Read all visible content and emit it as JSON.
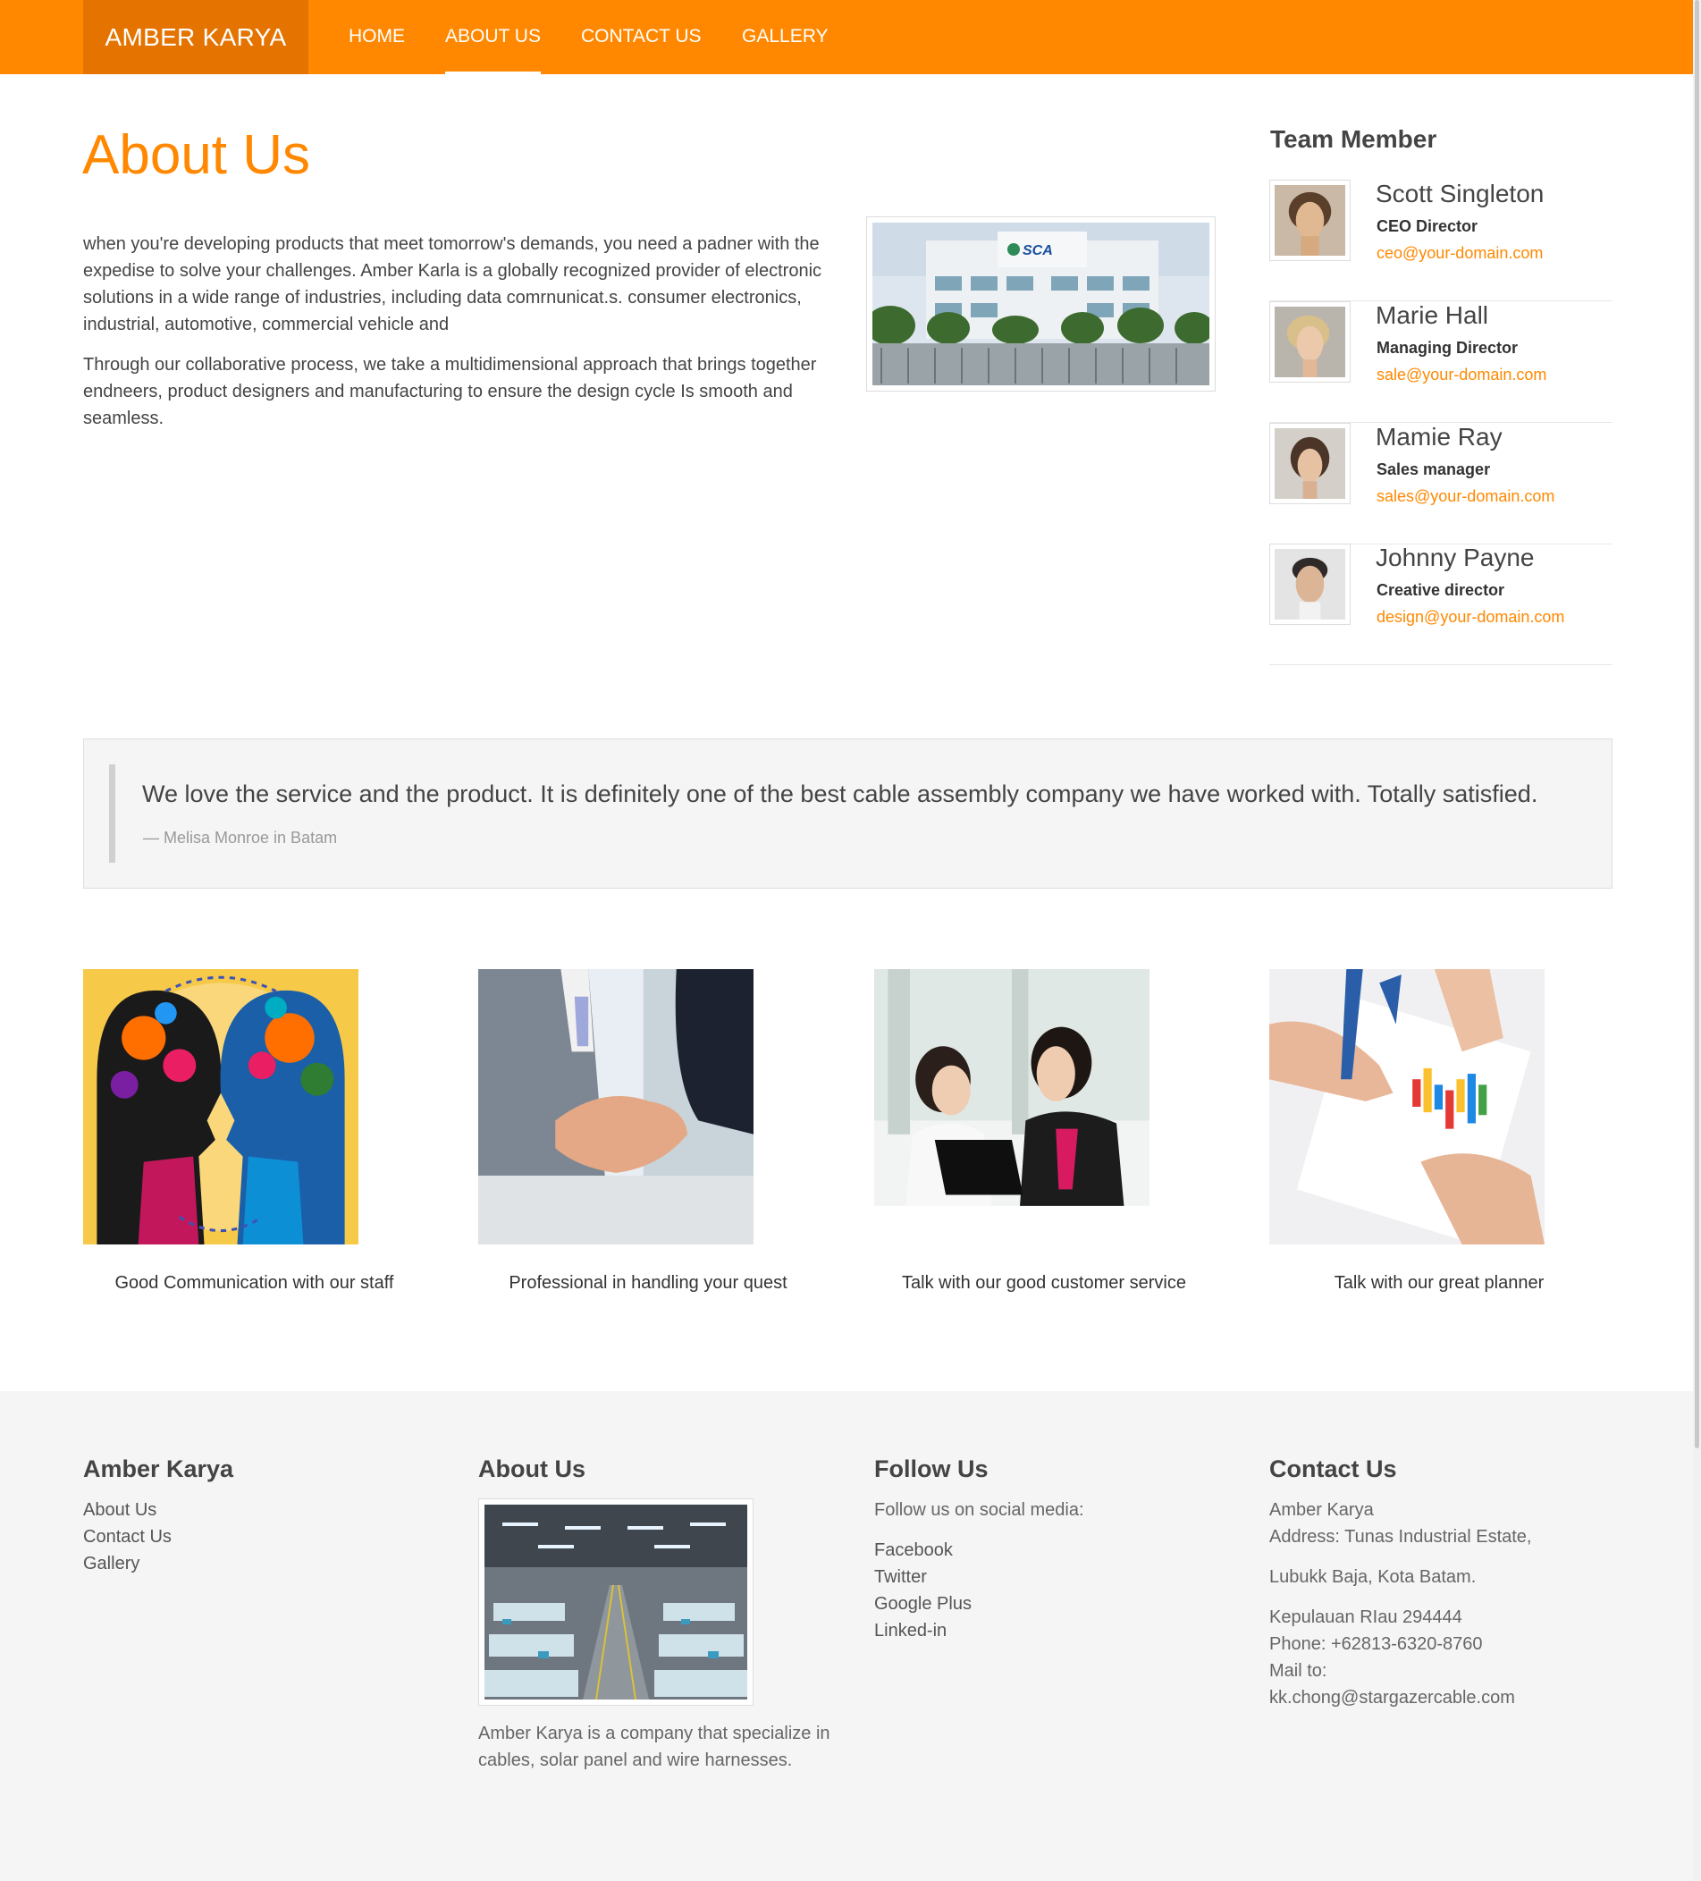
{
  "nav": {
    "brand": "AMBER KARYA",
    "items": [
      {
        "label": "HOME"
      },
      {
        "label": "ABOUT US"
      },
      {
        "label": "CONTACT US"
      },
      {
        "label": "GALLERY"
      }
    ]
  },
  "about": {
    "title": "About Us",
    "paragraphs": [
      "when you're developing products that meet tomorrow's demands, you need a padner with the expedise to solve your challenges. Amber Karla is a globally recognized provider of electronic solutions in a wide range of industries, including data comrnunicat.s. consumer electronics, industrial, automotive, commercial vehicle and",
      "Through our collaborative process, we take a multidimensional approach that brings together endneers, product designers and manufacturing to ensure the design cycle Is smooth and seamless."
    ],
    "building_sign": "SCA"
  },
  "team": {
    "title": "Team Member",
    "members": [
      {
        "name": "Scott Singleton",
        "role": "CEO Director",
        "email": "ceo@your-domain.com"
      },
      {
        "name": "Marie Hall",
        "role": "Managing Director",
        "email": "sale@your-domain.com"
      },
      {
        "name": "Mamie Ray",
        "role": "Sales manager",
        "email": "sales@your-domain.com"
      },
      {
        "name": "Johnny Payne",
        "role": "Creative director",
        "email": "design@your-domain.com"
      }
    ]
  },
  "testimonial": {
    "quote": "We love the service and the product. It is definitely one of the best cable assembly company we have worked with. Totally satisfied.",
    "cite": "— Melisa Monroe in Batam"
  },
  "features": [
    {
      "caption": "Good Communication with our staff"
    },
    {
      "caption": "Professional in handling your quest"
    },
    {
      "caption": "Talk with our good customer service"
    },
    {
      "caption": "Talk with our great planner"
    }
  ],
  "footer": {
    "col1": {
      "title": "Amber Karya",
      "links": [
        "About Us",
        "Contact Us",
        "Gallery"
      ]
    },
    "col2": {
      "title": "About Us",
      "text": "Amber Karya is a company that specialize in cables, solar panel and wire harnesses."
    },
    "col3": {
      "title": "Follow Us",
      "intro": "Follow us on social media:",
      "links": [
        "Facebook",
        "Twitter",
        "Google Plus",
        "Linked-in"
      ]
    },
    "col4": {
      "title": "Contact Us",
      "company": "Amber Karya",
      "address1": "Address: Tunas Industrial Estate,",
      "address2": "Lubukk Baja, Kota Batam.",
      "address3": "Kepulauan RIau 294444",
      "phone": "Phone: +62813-6320-8760",
      "mail_label": "Mail to:",
      "email": "kk.chong@stargazercable.com"
    }
  },
  "colors": {
    "accent": "#ff8800",
    "brand_bg": "#e57300",
    "footer_bg": "#f5f5f5"
  }
}
